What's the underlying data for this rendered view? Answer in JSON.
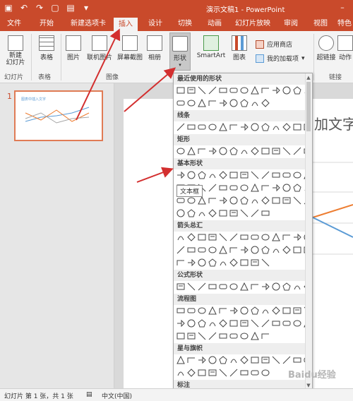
{
  "title_bar": {
    "document_title": "演示文稿1 - PowerPoint",
    "qat_icons": [
      "save-icon",
      "undo-icon",
      "redo-icon",
      "new-doc-icon",
      "open-icon",
      "customize-qat-icon"
    ]
  },
  "ribbon_tabs": [
    "文件",
    "开始",
    "新建选项卡",
    "插入",
    "设计",
    "切换",
    "动画",
    "幻灯片放映",
    "审阅",
    "视图",
    "特色"
  ],
  "active_tab": "插入",
  "ribbon": {
    "new_slide": "新建\n幻灯片",
    "table": "表格",
    "picture": "图片",
    "online_picture": "联机图片",
    "screenshot": "屏幕截图",
    "album": "相册",
    "shapes": "形状",
    "smartart": "SmartArt",
    "chart": "图表",
    "app_store": "应用商店",
    "my_addins": "我的加载项",
    "hyperlink": "超链接",
    "action": "动作",
    "groups": {
      "slides": "幻灯片",
      "tables": "表格",
      "images": "图像",
      "links": "链接"
    }
  },
  "thumbnail": {
    "slide_number": "1",
    "title_text": "图表中插入文字",
    "series_colors": [
      "#5b9bd5",
      "#ed7d31",
      "#a5a5a5"
    ]
  },
  "slide": {
    "visible_text": "加文字"
  },
  "shapes_panel": {
    "sections": [
      {
        "title": "最近使用的形状",
        "rows": 2
      },
      {
        "title": "线条",
        "rows": 1
      },
      {
        "title": "矩形",
        "rows": 1
      },
      {
        "title": "基本形状",
        "rows": 4
      },
      {
        "title": "箭头总汇",
        "rows": 3
      },
      {
        "title": "公式形状",
        "rows": 1
      },
      {
        "title": "流程图",
        "rows": 3
      },
      {
        "title": "星与旗帜",
        "rows": 2
      },
      {
        "title": "标注",
        "rows": 2
      }
    ],
    "tooltip": "文本框"
  },
  "status_bar": {
    "slide_info": "幻灯片 第 1 张，共 1 张",
    "language": "中文(中国)"
  },
  "watermark": "Baidu经验",
  "colors": {
    "accent": "#c94a2b",
    "arrow": "#d32f2f"
  }
}
